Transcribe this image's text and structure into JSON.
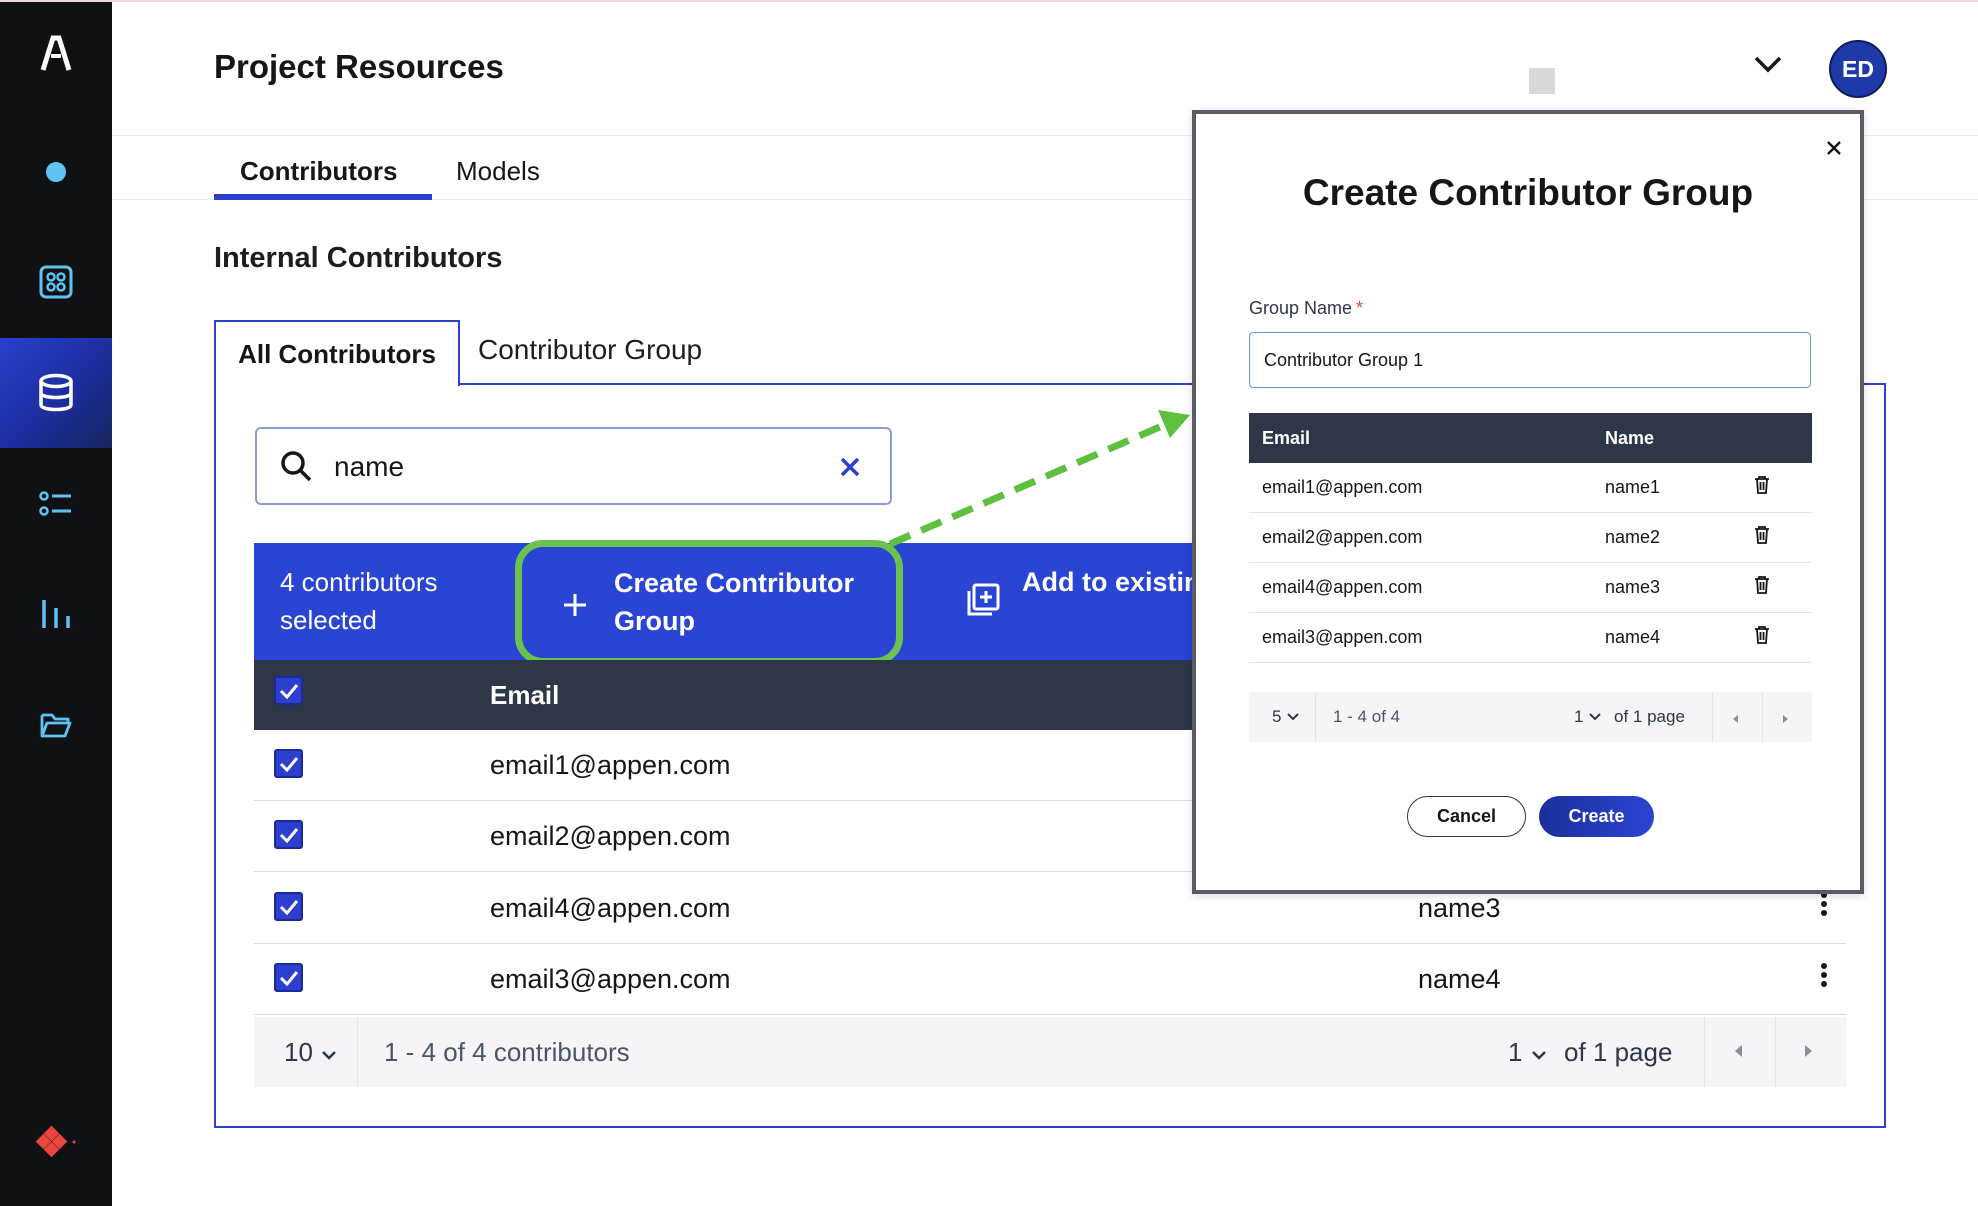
{
  "app": {
    "title": "Project Resources",
    "avatar_initials": "ED"
  },
  "tabs": [
    {
      "label": "Contributors",
      "active": true
    },
    {
      "label": "Models",
      "active": false
    }
  ],
  "section_title": "Internal Contributors",
  "subtabs": [
    {
      "label": "All Contributors",
      "active": true
    },
    {
      "label": "Contributor Group",
      "active": false
    }
  ],
  "search": {
    "value": "name"
  },
  "selection": {
    "count_text": "4 contributors selected",
    "create_group_label": "Create Contributor Group",
    "add_existing_label": "Add to existing Group"
  },
  "table": {
    "columns": {
      "email": "Email"
    },
    "rows": [
      {
        "email": "email1@appen.com",
        "name": "",
        "checked": true
      },
      {
        "email": "email2@appen.com",
        "name": "",
        "checked": true
      },
      {
        "email": "email4@appen.com",
        "name": "name3",
        "checked": true
      },
      {
        "email": "email3@appen.com",
        "name": "name4",
        "checked": true
      }
    ],
    "pager": {
      "page_size": "10",
      "range": "1 - 4 of 4 contributors",
      "page": "1",
      "of_pages": "of 1 page"
    }
  },
  "modal": {
    "title": "Create Contributor Group",
    "field_label": "Group Name",
    "required_mark": "*",
    "field_value": "Contributor Group 1",
    "columns": {
      "email": "Email",
      "name": "Name"
    },
    "rows": [
      {
        "email": "email1@appen.com",
        "name": "name1"
      },
      {
        "email": "email2@appen.com",
        "name": "name2"
      },
      {
        "email": "email4@appen.com",
        "name": "name3"
      },
      {
        "email": "email3@appen.com",
        "name": "name4"
      }
    ],
    "pager": {
      "page_size": "5",
      "range": "1 - 4 of 4",
      "page": "1",
      "of_pages": "of 1 page"
    },
    "cancel_label": "Cancel",
    "create_label": "Create"
  },
  "colors": {
    "accent": "#2a45d4",
    "highlight": "#6bc24e",
    "sidebar": "#101114",
    "table_header": "#2d3748"
  },
  "icons": {
    "sidebar": [
      "logo-a-icon",
      "dot-icon",
      "grid-icon",
      "database-icon",
      "list-icon",
      "chart-icon",
      "folder-icon",
      "brand-diamond-icon"
    ],
    "other": [
      "chevron-down-icon",
      "search-icon",
      "clear-icon",
      "plus-icon",
      "add-to-group-icon",
      "kebab-icon",
      "trash-icon",
      "close-icon",
      "arrow-left-icon",
      "arrow-right-icon"
    ]
  }
}
